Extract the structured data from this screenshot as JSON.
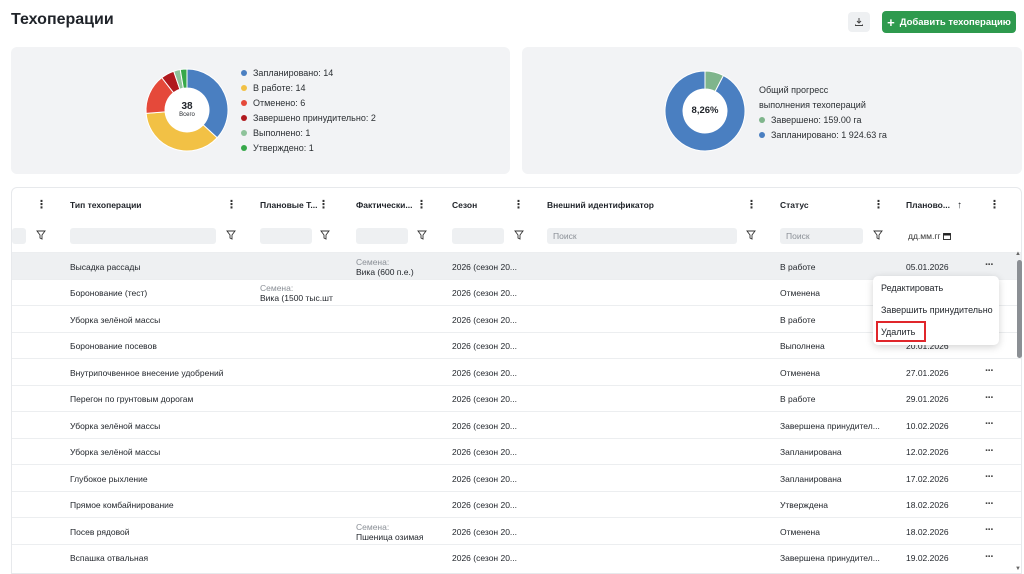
{
  "page": {
    "title": "Техоперации",
    "add_button": "Добавить техоперацию",
    "export_icon": "download-icon",
    "accent": "#2e9a4e"
  },
  "stats_left": {
    "total": "38",
    "total_label": "Всего",
    "items": [
      {
        "label": "Запланировано: 14",
        "value": 14,
        "color": "#4a7fc1"
      },
      {
        "label": "В работе: 14",
        "value": 14,
        "color": "#f2c145"
      },
      {
        "label": "Отменено: 6",
        "value": 6,
        "color": "#e5493a"
      },
      {
        "label": "Завершено принудительно: 2",
        "value": 2,
        "color": "#b0191e"
      },
      {
        "label": "Выполнено: 1",
        "value": 1,
        "color": "#8ec39a"
      },
      {
        "label": "Утверждено: 1",
        "value": 1,
        "color": "#37a84a"
      }
    ]
  },
  "stats_right": {
    "percent": "8,26%",
    "title_line1": "Общий прогресс",
    "title_line2": "выполнения техопераций",
    "items": [
      {
        "label": "Завершено: 159.00 га",
        "value": 159.0,
        "color": "#7fb58c"
      },
      {
        "label": "Запланировано: 1 924.63 га",
        "value": 1924.63,
        "color": "#4a7fc1"
      }
    ]
  },
  "table": {
    "headers": {
      "type": "Тип техоперации",
      "planned": "Плановые Т...",
      "actual": "Фактически...",
      "season": "Сезон",
      "external": "Внешний идентификатор",
      "status": "Статус",
      "planned_date": "Планово..."
    },
    "filters": {
      "external_placeholder": "Поиск",
      "status_placeholder": "Поиск",
      "date_placeholder": "дд.мм.гг"
    },
    "rows": [
      {
        "type": "Высадка рассады",
        "planned_label": "",
        "planned_value": "",
        "actual_label": "Семена:",
        "actual_value": "Вика (600 п.е.)",
        "season": "2026 (сезон 20...",
        "status": "В работе",
        "date": "05.01.2026"
      },
      {
        "type": "Боронование (тест)",
        "planned_label": "Семена:",
        "planned_value": "Вика (1500 тыс.шт",
        "actual_label": "",
        "actual_value": "",
        "season": "2026 (сезон 20...",
        "status": "Отменена",
        "date": ""
      },
      {
        "type": "Уборка зелёной массы",
        "planned_label": "",
        "planned_value": "",
        "actual_label": "",
        "actual_value": "",
        "season": "2026 (сезон 20...",
        "status": "В работе",
        "date": ""
      },
      {
        "type": "Боронование посевов",
        "planned_label": "",
        "planned_value": "",
        "actual_label": "",
        "actual_value": "",
        "season": "2026 (сезон 20...",
        "status": "Выполнена",
        "date": "20.01.2026"
      },
      {
        "type": "Внутрипочвенное внесение удобрений",
        "planned_label": "",
        "planned_value": "",
        "actual_label": "",
        "actual_value": "",
        "season": "2026 (сезон 20...",
        "status": "Отменена",
        "date": "27.01.2026"
      },
      {
        "type": "Перегон по грунтовым дорогам",
        "planned_label": "",
        "planned_value": "",
        "actual_label": "",
        "actual_value": "",
        "season": "2026 (сезон 20...",
        "status": "В работе",
        "date": "29.01.2026"
      },
      {
        "type": "Уборка зелёной массы",
        "planned_label": "",
        "planned_value": "",
        "actual_label": "",
        "actual_value": "",
        "season": "2026 (сезон 20...",
        "status": "Завершена принудител...",
        "date": "10.02.2026"
      },
      {
        "type": "Уборка зелёной массы",
        "planned_label": "",
        "planned_value": "",
        "actual_label": "",
        "actual_value": "",
        "season": "2026 (сезон 20...",
        "status": "Запланирована",
        "date": "12.02.2026"
      },
      {
        "type": "Глубокое рыхление",
        "planned_label": "",
        "planned_value": "",
        "actual_label": "",
        "actual_value": "",
        "season": "2026 (сезон 20...",
        "status": "Запланирована",
        "date": "17.02.2026"
      },
      {
        "type": "Прямое комбайнирование",
        "planned_label": "",
        "planned_value": "",
        "actual_label": "",
        "actual_value": "",
        "season": "2026 (сезон 20...",
        "status": "Утверждена",
        "date": "18.02.2026"
      },
      {
        "type": "Посев рядовой",
        "planned_label": "",
        "planned_value": "",
        "actual_label": "Семена:",
        "actual_value": "Пшеница озимая",
        "season": "2026 (сезон 20...",
        "status": "Отменена",
        "date": "18.02.2026"
      },
      {
        "type": "Вспашка отвальная",
        "planned_label": "",
        "planned_value": "",
        "actual_label": "",
        "actual_value": "",
        "season": "2026 (сезон 20...",
        "status": "Завершена принудител...",
        "date": "19.02.2026"
      }
    ]
  },
  "context_menu": {
    "edit": "Редактировать",
    "force_finish": "Завершить принудительно",
    "delete": "Удалить",
    "highlight_color": "#e0262b"
  }
}
